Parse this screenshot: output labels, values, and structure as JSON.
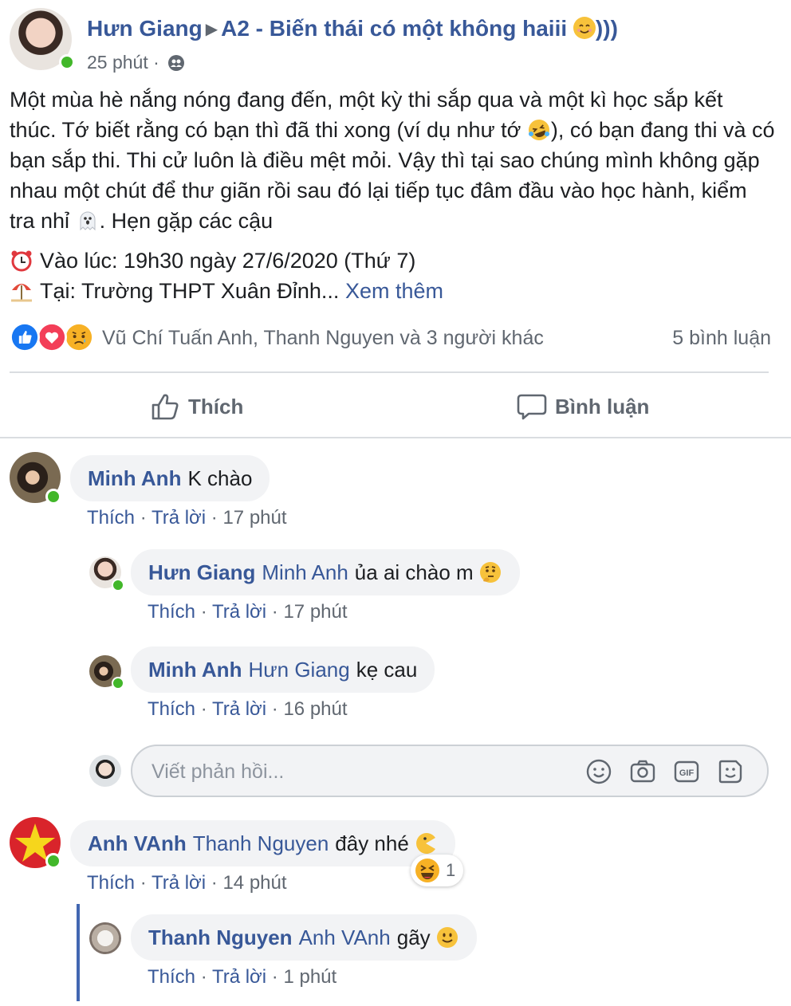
{
  "post": {
    "author": "Hưn Giang",
    "arrow": "▶",
    "group": "A2 - Biến thái có một không haiii",
    "group_suffix": ")))",
    "time": "25 phút ·",
    "body": "Một mùa hè nắng nóng đang đến, một kỳ thi sắp qua và một kì học sắp kết thúc. Tớ biết rằng có bạn thì đã thi xong (ví dụ như tớ",
    "body_2": "), có bạn đang thi và có bạn sắp thi. Thi cử luôn là điều mệt mỏi. Vậy thì tại sao chúng mình không gặp nhau một chút để thư giãn rồi sau đó lại tiếp tục đâm đầu vào học hành, kiểm tra nhỉ",
    "body_3": ". Hẹn gặp các cậu",
    "time_line": "Vào lúc: 19h30 ngày 27/6/2020 (Thứ 7)",
    "place_line": "Tại: Trường THPT Xuân Đỉnh...",
    "see_more": "Xem thêm"
  },
  "reactions": {
    "names": "Vũ Chí Tuấn Anh, Thanh Nguyen và 3 người khác",
    "comment_count": "5 bình luận",
    "colors": {
      "like": "#1877f2",
      "love": "#f33e58",
      "sad": "#f7b125"
    }
  },
  "actions": {
    "like": "Thích",
    "comment": "Bình luận"
  },
  "comments": [
    {
      "author": "Minh Anh",
      "mention": "",
      "text": "K chào",
      "like": "Thích",
      "reply": "Trả lời",
      "time": "17 phút"
    },
    {
      "author": "Hưn Giang",
      "mention": "Minh Anh",
      "text": "ủa ai chào m",
      "like": "Thích",
      "reply": "Trả lời",
      "time": "17 phút"
    },
    {
      "author": "Minh Anh",
      "mention": "Hưn Giang",
      "text": "kẹ cau",
      "like": "Thích",
      "reply": "Trả lời",
      "time": "16 phút"
    },
    {
      "author": "Anh VAnh",
      "mention": "Thanh Nguyen",
      "text": "đây nhé",
      "like": "Thích",
      "reply": "Trả lời",
      "time": "14 phút",
      "reaction_count": "1"
    },
    {
      "author": "Thanh Nguyen",
      "mention": "Anh VAnh",
      "text": "gãy",
      "like": "Thích",
      "reply": "Trả lời",
      "time": "1 phút"
    }
  ],
  "reply_box": {
    "placeholder": "Viết phản hồi...",
    "icons": [
      "emoji-icon",
      "camera-icon",
      "gif-icon",
      "sticker-icon"
    ]
  },
  "sep": " · "
}
